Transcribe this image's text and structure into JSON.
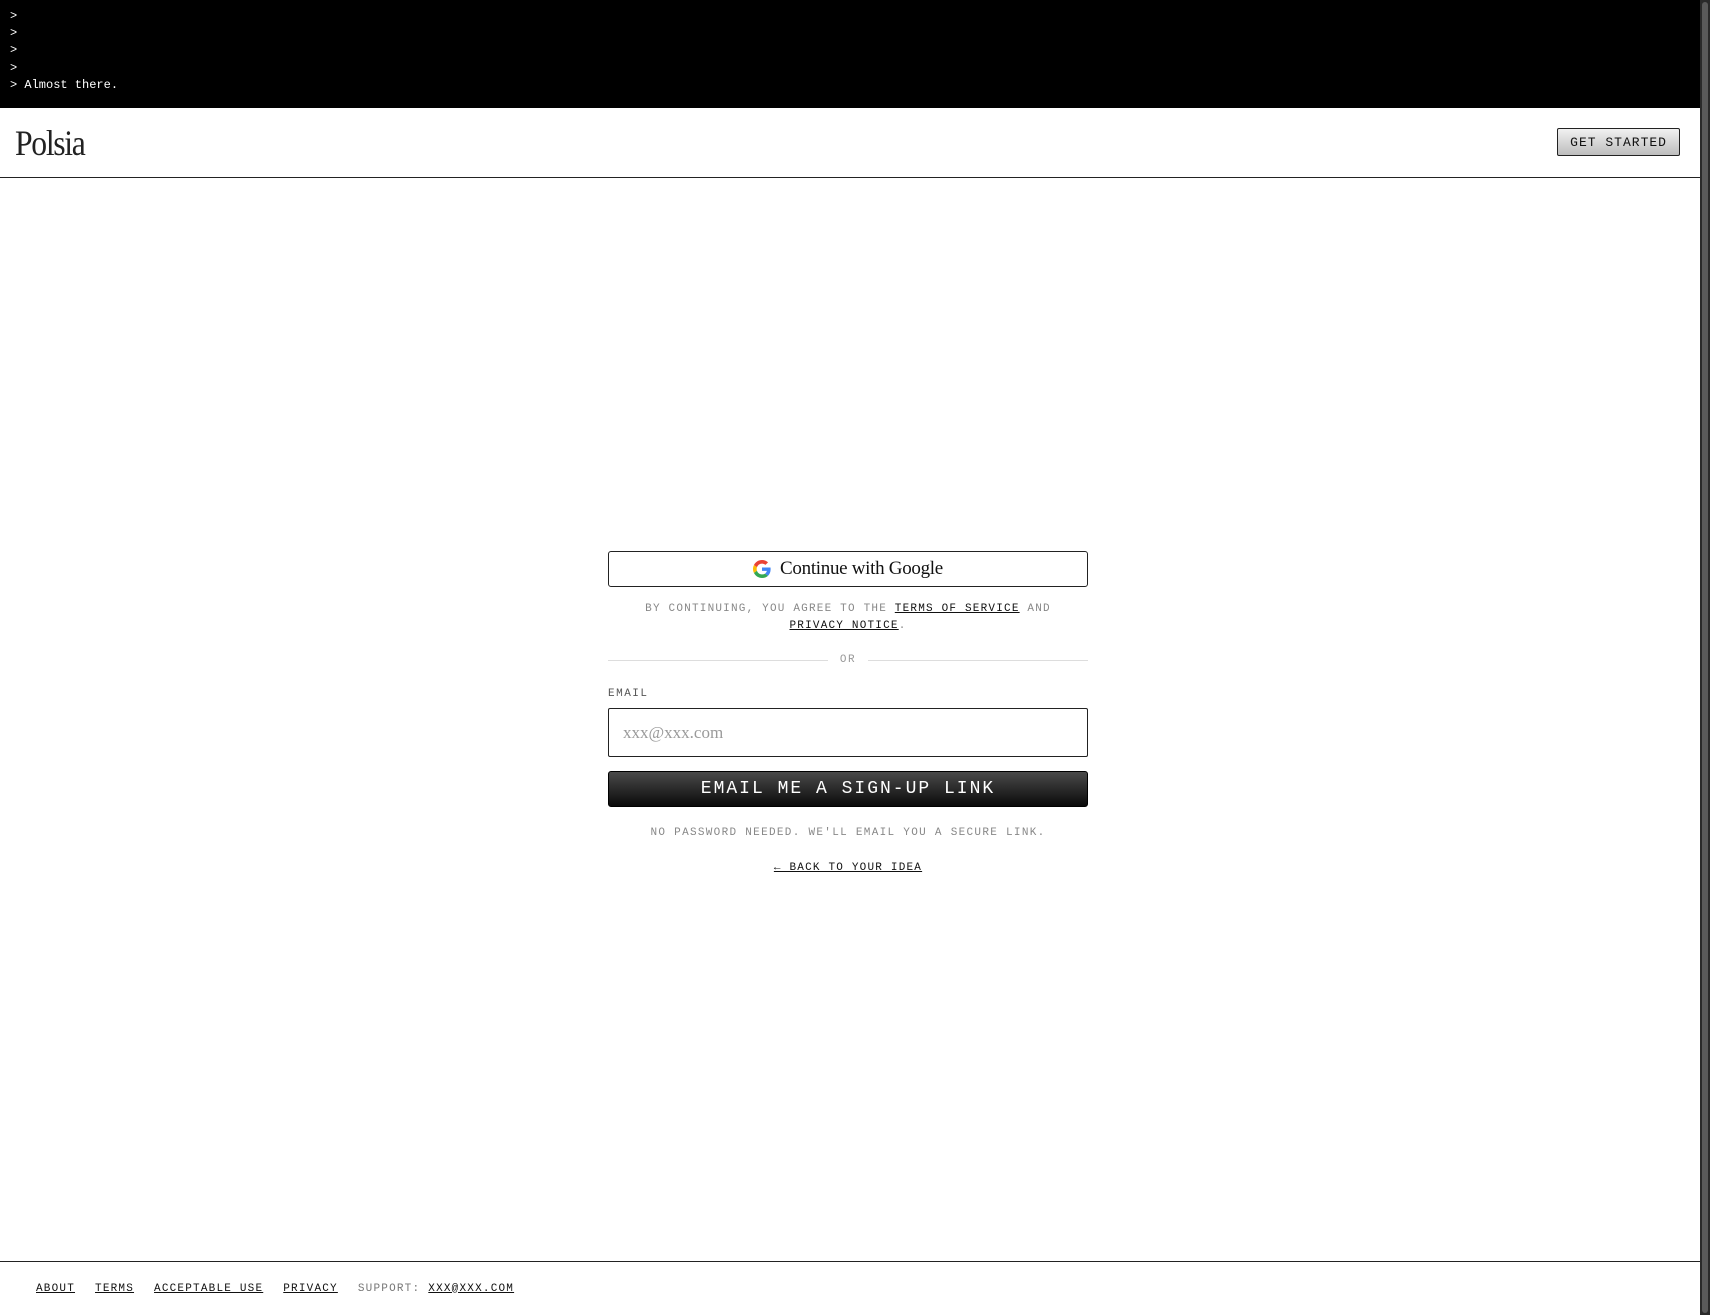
{
  "terminal": {
    "lines": [
      ">",
      ">",
      ">",
      ">",
      "> Almost there."
    ]
  },
  "header": {
    "logo": "Polsia",
    "get_started_label": "GET STARTED"
  },
  "auth": {
    "google_button_label": "Continue with Google",
    "consent_prefix": "BY CONTINUING, YOU AGREE TO THE ",
    "terms_link": "TERMS OF SERVICE",
    "consent_and": " AND ",
    "privacy_link": "PRIVACY NOTICE",
    "consent_suffix": ".",
    "divider": "OR",
    "email_label": "EMAIL",
    "email_placeholder": "xxx@xxx.com",
    "email_value": "",
    "submit_label": "EMAIL ME A SIGN-UP LINK",
    "helper_text": "NO PASSWORD NEEDED. WE'LL EMAIL YOU A SECURE LINK.",
    "back_link": "← BACK TO YOUR IDEA"
  },
  "footer": {
    "links": [
      "ABOUT",
      "TERMS",
      "ACCEPTABLE USE",
      "PRIVACY"
    ],
    "support_label": "SUPPORT:",
    "support_email": "XXX@XXX.COM"
  },
  "icons": {
    "google": "google-g-icon"
  },
  "colors": {
    "terminal_bg": "#000000",
    "primary_button": "#111111",
    "muted_text": "#888888"
  }
}
